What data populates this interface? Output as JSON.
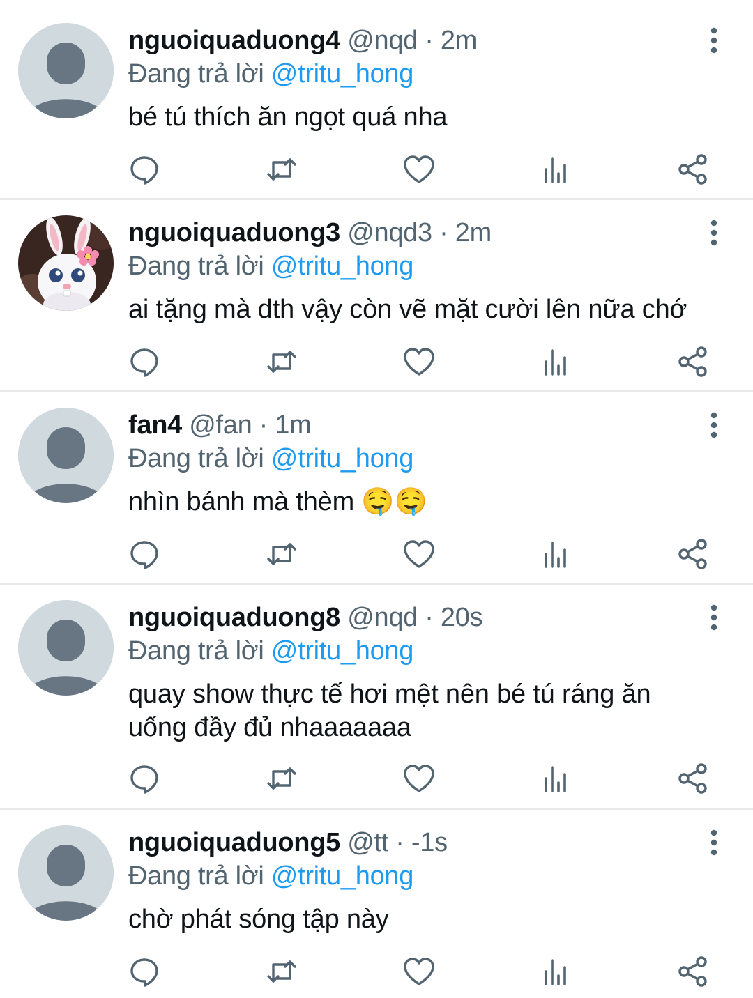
{
  "reply_prefix": "Đang trả lời",
  "icons": {
    "reply": "reply-icon",
    "retweet": "retweet-icon",
    "like": "like-icon",
    "views": "views-icon",
    "share": "share-icon",
    "more": "more-vertical-icon"
  },
  "colors": {
    "mention": "#1d9bf0",
    "secondary_text": "#536471",
    "primary_text": "#0f1419",
    "icon": "#536471",
    "divider": "#e7e9ea",
    "avatar_bg": "#cfd9de",
    "avatar_figure": "#687684"
  },
  "tweets": [
    {
      "display_name": "nguoiquaduong4",
      "handle": "@nqd",
      "time": "2m",
      "reply_to": "@tritu_hong",
      "text": "bé tú thích ăn ngọt quá nha",
      "avatar": "default"
    },
    {
      "display_name": "nguoiquaduong3",
      "handle": "@nqd3",
      "time": "2m",
      "reply_to": "@tritu_hong",
      "text": "ai tặng mà dth vậy còn vẽ mặt cười lên nữa chớ",
      "avatar": "bunny"
    },
    {
      "display_name": "fan4",
      "handle": "@fan",
      "time": "1m",
      "reply_to": "@tritu_hong",
      "text": "nhìn bánh mà thèm 🤤🤤",
      "avatar": "default"
    },
    {
      "display_name": "nguoiquaduong8",
      "handle": "@nqd",
      "time": "20s",
      "reply_to": "@tritu_hong",
      "text": "quay show thực tế hơi mệt nên bé tú ráng ăn uống đầy đủ nhaaaaaaa",
      "avatar": "default"
    },
    {
      "display_name": "nguoiquaduong5",
      "handle": "@tt",
      "time": "-1s",
      "reply_to": "@tritu_hong",
      "text": "chờ phát sóng tập này",
      "avatar": "default"
    }
  ]
}
